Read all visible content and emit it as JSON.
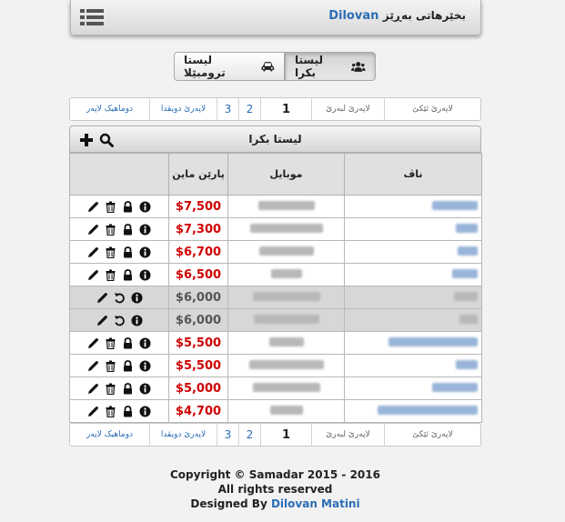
{
  "header": {
    "brand_name": "Dilovan",
    "brand_label": "بخێرهاتی بەڕێز"
  },
  "switcher": {
    "left_label": "لیستا ترومبێلا",
    "right_label": "لیستا بکرا"
  },
  "pager": {
    "last": "دوماهیک لاپەر",
    "next": "لاپەرێ دویڤدا",
    "p3": "3",
    "p2": "2",
    "current": "1",
    "prev": "لاپەرێ لبەرێ",
    "first": "لاپەرێ ئێکێ"
  },
  "panel": {
    "title": "لیستا بکرا"
  },
  "table": {
    "headers": {
      "price": "پارێن ماین",
      "mobile": "موبایل",
      "name": "ناڤ"
    },
    "rows": [
      {
        "price": "$7,500",
        "shaded": false,
        "name_w": 50,
        "name_color": "blue",
        "mob_w": 62
      },
      {
        "price": "$7,300",
        "shaded": false,
        "name_w": 24,
        "name_color": "blue",
        "mob_w": 80
      },
      {
        "price": "$6,700",
        "shaded": false,
        "name_w": 22,
        "name_color": "blue",
        "mob_w": 60
      },
      {
        "price": "$6,500",
        "shaded": false,
        "name_w": 28,
        "name_color": "blue",
        "mob_w": 34
      },
      {
        "price": "$6,000",
        "shaded": true,
        "name_w": 26,
        "name_color": "gray",
        "mob_w": 74
      },
      {
        "price": "$6,000",
        "shaded": true,
        "name_w": 20,
        "name_color": "gray",
        "mob_w": 72
      },
      {
        "price": "$5,500",
        "shaded": false,
        "name_w": 98,
        "name_color": "blue",
        "mob_w": 38
      },
      {
        "price": "$5,500",
        "shaded": false,
        "name_w": 24,
        "name_color": "blue",
        "mob_w": 82
      },
      {
        "price": "$5,000",
        "shaded": false,
        "name_w": 50,
        "name_color": "blue",
        "mob_w": 74
      },
      {
        "price": "$4,700",
        "shaded": false,
        "name_w": 110,
        "name_color": "blue",
        "mob_w": 36
      }
    ]
  },
  "footer": {
    "copyright": "Copyright © Samadar 2015 - 2016",
    "rights": "All rights reserved",
    "designed_by": "Designed By",
    "designer": "Dilovan Matini"
  },
  "icons": {
    "menu": "menu-icon",
    "users": "users-icon",
    "car": "car-icon",
    "search": "search-icon",
    "plus": "plus-icon",
    "edit": "pencil-icon",
    "delete": "trash-icon",
    "lock": "lock-icon",
    "info": "info-icon",
    "restore": "undo-icon"
  },
  "colors": {
    "accent": "#2a6db5",
    "price": "#d00000",
    "shaded_row": "#d7d7d7"
  }
}
